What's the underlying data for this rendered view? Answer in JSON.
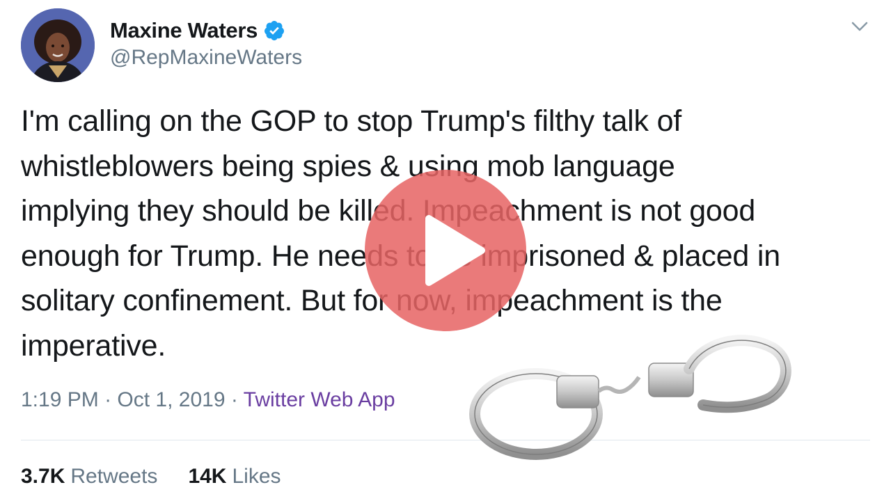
{
  "profile": {
    "display_name": "Maxine Waters",
    "handle": "@RepMaxineWaters",
    "verified_icon": "verified-badge-icon"
  },
  "tweet": {
    "lines": [
      "I'm calling on the GOP to stop Trump's filthy talk of",
      "whistleblowers being spies & using mob language",
      "implying they should be killed. Impeachment is not good",
      "enough for Trump. He needs to be imprisoned & placed in",
      "solitary confinement. But for now, impeachment is the",
      "imperative."
    ],
    "time": "1:19 PM",
    "separator": "·",
    "date": "Oct 1, 2019",
    "source": "Twitter Web App"
  },
  "stats": {
    "retweets_count": "3.7K",
    "retweets_label": "Retweets",
    "likes_count": "14K",
    "likes_label": "Likes"
  },
  "overlay": {
    "play_icon": "play-icon",
    "image_icon": "handcuffs-icon"
  },
  "colors": {
    "text": "#14171a",
    "secondary": "#657786",
    "link": "#6a3ea1",
    "verified": "#1da1f2",
    "play_button": "#e66464"
  }
}
